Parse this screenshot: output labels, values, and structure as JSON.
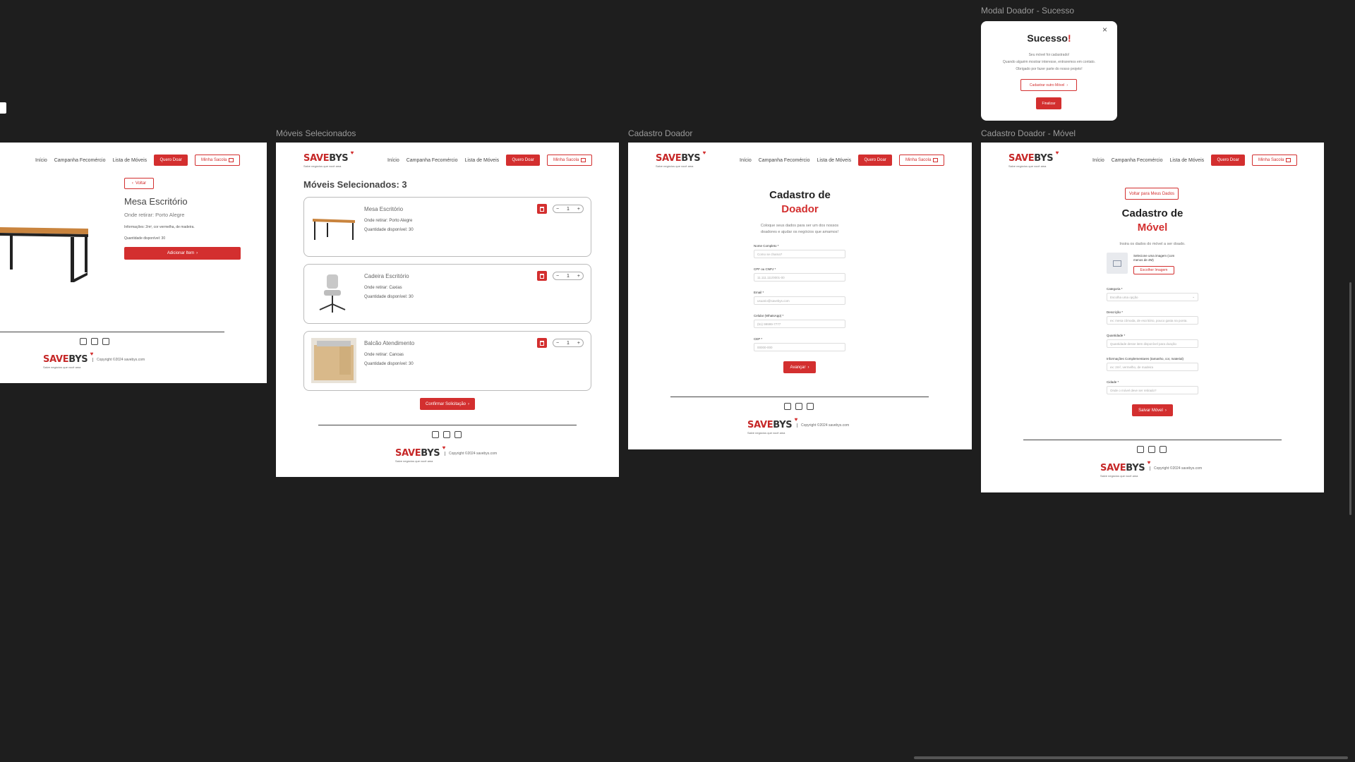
{
  "frames": {
    "product": {
      "title": ""
    },
    "selected": {
      "title": "Móveis Selecionados"
    },
    "donor": {
      "title": "Cadastro Doador"
    },
    "furniture": {
      "title": "Cadastro Doador - Móvel"
    },
    "modal": {
      "title": "Modal Doador - Sucesso"
    }
  },
  "nav": {
    "inicio": "Início",
    "campanha": "Campanha Fecomércio",
    "lista": "Lista de Móveis",
    "quero_doar": "Quero Doar",
    "minha_sacola": "Minha Sacola"
  },
  "logo": {
    "word_a": "SAVE",
    "word_b": "BYS",
    "tagline": "Salve negócios que você ama"
  },
  "footer": {
    "copyright": "Copyright ©2024 savebys.com"
  },
  "product": {
    "back": "Voltar",
    "title": "Mesa Escritório",
    "pickup": "Onde retirar: Porto Alegre",
    "details": "Informações: 2m², cor vermelha, de madeira.",
    "qty": "Quantidade disponível: 30",
    "add": "Adicionar Item"
  },
  "selected": {
    "heading": "Móveis Selecionados: 3",
    "items": [
      {
        "name": "Mesa Escritório",
        "pickup": "Onde retirar: Porto Alegre",
        "qty": "Quantidade disponível: 30",
        "count": "1"
      },
      {
        "name": "Cadeira Escritório",
        "pickup": "Onde retirar: Caxias",
        "qty": "Quantidade disponível: 30",
        "count": "1"
      },
      {
        "name": "Balcão Atendimento",
        "pickup": "Onde retirar: Canoas",
        "qty": "Quantidade disponível: 30",
        "count": "1"
      }
    ],
    "confirm": "Confirmar Solicitação"
  },
  "donor": {
    "title_a": "Cadastro de",
    "title_b": "Doador",
    "subtitle": "Coloque seus dados para ser um dos nossos doadores e ajudar os negócios que amamos!",
    "fields": [
      {
        "label": "Nome Completo *",
        "placeholder": "Como se chama?"
      },
      {
        "label": "CPF ou CNPJ *",
        "placeholder": "11.111.111/0001-00"
      },
      {
        "label": "Email *",
        "placeholder": "usuario@savebys.com"
      },
      {
        "label": "Celular (WhatsApp) *",
        "placeholder": "(51) 99999-7777"
      },
      {
        "label": "CEP *",
        "placeholder": "00000-000"
      }
    ],
    "next": "Avançar"
  },
  "furniture": {
    "back": "Voltar para Meus Dados",
    "title_a": "Cadastro de",
    "title_b": "Móvel",
    "subtitle": "Insira os dados do móvel a ser doado.",
    "image_hint": "Selecione uma imagem (com menos de 4M)",
    "choose": "Escolher Imagem",
    "fields": [
      {
        "label": "Categoria *",
        "placeholder": "Escolha uma opção"
      },
      {
        "label": "Descrição *",
        "placeholder": "ex: mesa cômoda, de escritório, pouco gasta na ponta."
      },
      {
        "label": "Quantidade *",
        "placeholder": "Quantidade desse item disponível para doação"
      },
      {
        "label": "Informações Complementares (tamanho, cor, material)",
        "placeholder": "ex: 2m², vermelho, de madeira"
      },
      {
        "label": "Cidade *",
        "placeholder": "Onde o móvel deve ser retirado?"
      }
    ],
    "save": "Salvar Móvel"
  },
  "modal": {
    "title_a": "Sucesso",
    "title_b": "!",
    "line1": "Seu móvel foi cadastrado!",
    "line2": "Quando alguém mostrar interesse, entraremos em contato.",
    "line3": "Obrigado por fazer parte do nosso projeto!",
    "again": "Cadastrar outro Móvel",
    "finish": "Finalizar"
  }
}
